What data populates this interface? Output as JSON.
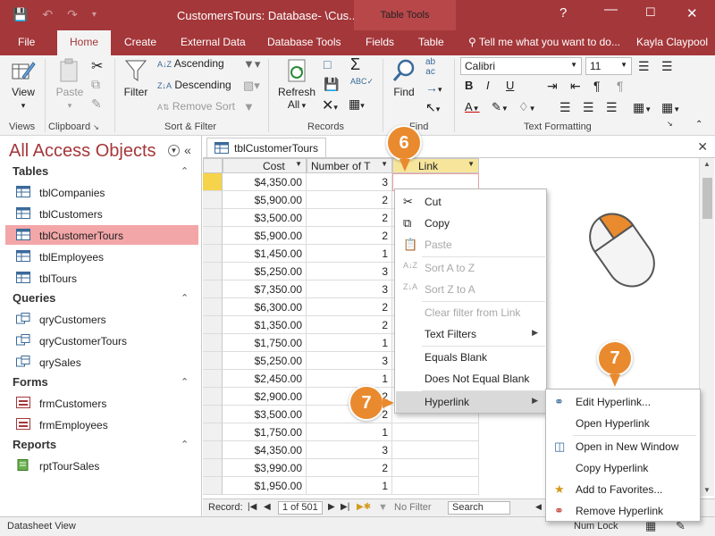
{
  "titlebar": {
    "title": "CustomersTours: Database- \\Cus...",
    "table_tools": "Table Tools",
    "user": "Kayla Claypool"
  },
  "tabs": [
    "File",
    "Home",
    "Create",
    "External Data",
    "Database Tools",
    "Fields",
    "Table"
  ],
  "tellme": "Tell me what you want to do...",
  "ribbon": {
    "view": "View",
    "paste": "Paste",
    "filter": "Filter",
    "ascending": "Ascending",
    "descending": "Descending",
    "remove_sort": "Remove Sort",
    "refresh": "Refresh",
    "refresh_all": "All",
    "find": "Find",
    "font_name": "Calibri",
    "font_size": "11",
    "groups": [
      "Views",
      "Clipboard",
      "Sort & Filter",
      "Records",
      "Find",
      "Text Formatting"
    ]
  },
  "nav": {
    "title": "All Access Objects",
    "sections": [
      {
        "label": "Tables",
        "items": [
          "tblCompanies",
          "tblCustomers",
          "tblCustomerTours",
          "tblEmployees",
          "tblTours"
        ]
      },
      {
        "label": "Queries",
        "items": [
          "qryCustomers",
          "qryCustomerTours",
          "qrySales"
        ]
      },
      {
        "label": "Forms",
        "items": [
          "frmCustomers",
          "frmEmployees"
        ]
      },
      {
        "label": "Reports",
        "items": [
          "rptTourSales"
        ]
      }
    ],
    "selected": "tblCustomerTours"
  },
  "doc": {
    "tab": "tblCustomerTours",
    "columns": [
      "Cost",
      "Number of T",
      "Link"
    ],
    "costs": [
      "$4,350.00",
      "$5,900.00",
      "$3,500.00",
      "$5,900.00",
      "$1,450.00",
      "$5,250.00",
      "$7,350.00",
      "$6,300.00",
      "$1,350.00",
      "$1,750.00",
      "$5,250.00",
      "$2,450.00",
      "$2,900.00",
      "$3,500.00",
      "$1,750.00",
      "$4,350.00",
      "$3,990.00",
      "$1,950.00"
    ],
    "numbers": [
      "3",
      "2",
      "2",
      "2",
      "1",
      "3",
      "3",
      "2",
      "2",
      "1",
      "3",
      "1",
      "2",
      "2",
      "1",
      "3",
      "2",
      "1"
    ]
  },
  "recbar": {
    "label": "Record:",
    "position": "1 of 501",
    "nofilter": "No Filter",
    "search": "Search"
  },
  "status": {
    "left": "Datasheet View",
    "numlock": "Num Lock"
  },
  "context_menu": {
    "items": [
      {
        "label": "Cut",
        "icon": "scissors-icon"
      },
      {
        "label": "Copy",
        "icon": "copy-icon"
      },
      {
        "label": "Paste",
        "icon": "paste-icon"
      },
      {
        "label": "Sort A to Z",
        "icon": "sort-asc-icon"
      },
      {
        "label": "Sort Z to A",
        "icon": "sort-desc-icon"
      },
      {
        "label": "Clear filter from Link"
      },
      {
        "label": "Text Filters"
      },
      {
        "label": "Equals Blank"
      },
      {
        "label": "Does Not Equal Blank"
      },
      {
        "label": "Hyperlink"
      }
    ]
  },
  "submenu": {
    "items": [
      "Edit Hyperlink...",
      "Open Hyperlink",
      "Open in New Window",
      "Copy Hyperlink",
      "Add to Favorites...",
      "Remove Hyperlink"
    ]
  },
  "callouts": [
    "6",
    "7",
    "7"
  ],
  "colors": {
    "accent": "#a4373a",
    "callout": "#e98a2e",
    "selected_nav": "#f3a6a8"
  }
}
